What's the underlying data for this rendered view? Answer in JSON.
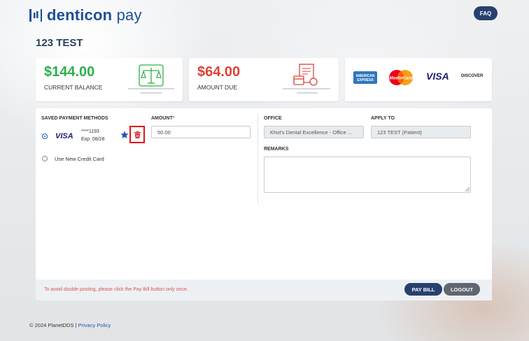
{
  "brand": {
    "name_bold": "denticon",
    "name_light": " pay",
    "color": "#1f4e9a"
  },
  "header": {
    "faq_label": "FAQ"
  },
  "patient": {
    "name": "123 TEST"
  },
  "summary": {
    "current_balance": {
      "amount": "$144.00",
      "label": "CURRENT BALANCE",
      "color": "#2db04b"
    },
    "amount_due": {
      "amount": "$64.00",
      "label": "AMOUNT DUE",
      "color": "#d9443a"
    },
    "card_brands": [
      "AMERICAN EXPRESS",
      "MasterCard",
      "VISA",
      "DISCOVER"
    ]
  },
  "payment": {
    "saved_methods_label": "SAVED PAYMENT METHODS",
    "saved_card": {
      "brand": "VISA",
      "number": "****1193",
      "expiry": "Exp: 08/28",
      "selected": true
    },
    "new_card_label": "Use New Credit Card",
    "amount_label": "AMOUNT",
    "amount_required_mark": "*",
    "amount_value": "50.00"
  },
  "office": {
    "office_label": "OFFICE",
    "office_value": "Khot's Dental Excellence - Office ...",
    "apply_to_label": "APPLY TO",
    "apply_to_value": "123  TEST (Patient)",
    "remarks_label": "REMARKS",
    "remarks_value": ""
  },
  "actions": {
    "notice": "To avoid double posting, please click the Pay Bill button only once.",
    "pay_bill_label": "PAY BILL",
    "logout_label": "LOGOUT"
  },
  "footer": {
    "copyright": "© 2024 PlanetDDS | ",
    "privacy_link": "Privacy Policy"
  }
}
